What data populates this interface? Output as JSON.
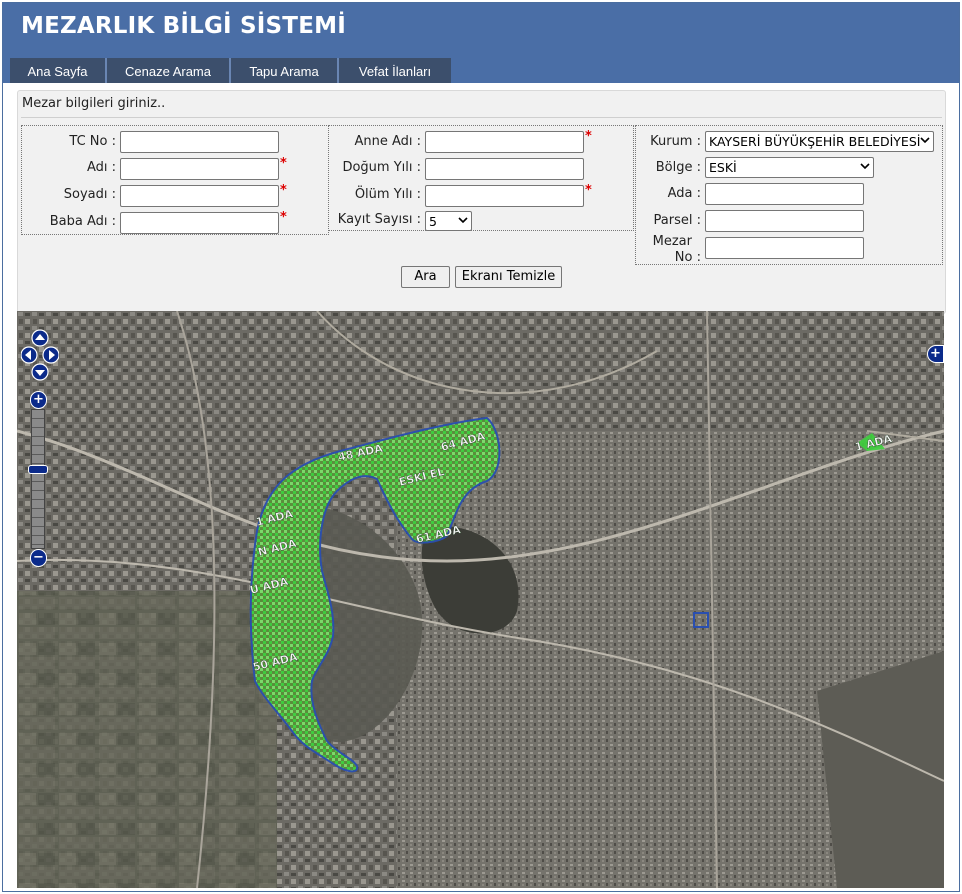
{
  "header": {
    "title": "MEZARLIK BİLGİ SİSTEMİ"
  },
  "nav": {
    "tabs": [
      {
        "label": "Ana Sayfa"
      },
      {
        "label": "Cenaze Arama"
      },
      {
        "label": "Tapu Arama"
      },
      {
        "label": "Vefat İlanları"
      }
    ]
  },
  "form": {
    "info_text": "Mezar bilgileri giriniz..",
    "col1": {
      "tc_label": "TC No :",
      "adi_label": "Adı :",
      "soyadi_label": "Soyadı :",
      "baba_label": "Baba Adı :"
    },
    "col2": {
      "anne_label": "Anne Adı :",
      "dogum_label": "Doğum Yılı :",
      "olum_label": "Ölüm Yılı :",
      "kayit_label": "Kayıt Sayısı :",
      "kayit_value": "5"
    },
    "col3": {
      "kurum_label": "Kurum :",
      "kurum_value": "KAYSERİ BÜYÜKŞEHİR BELEDİYESİ",
      "bolge_label": "Bölge :",
      "bolge_value": "ESKİ",
      "ada_label": "Ada :",
      "parsel_label": "Parsel :",
      "mezar_label_1": "Mezar",
      "mezar_label_2": "No :"
    },
    "required_mark": "*",
    "search_button": "Ara",
    "clear_button": "Ekranı Temizle"
  },
  "map": {
    "labels": {
      "ada48": "48 ADA",
      "ada64": "64 ADA",
      "eski": "ESKİ EL",
      "ada61": "61 ADA",
      "ada1": "1 ADA",
      "adaN": "N ADA",
      "adaU": "U ADA",
      "ada50": "50 ADA",
      "ada1b": "1 ADA"
    },
    "controls": {
      "zoom_in": "+",
      "zoom_out": "−",
      "layer_switcher": "+"
    },
    "colors": {
      "cemetery": "#3dd13d",
      "boundary": "#2a4fb0",
      "control": "#0b2a8a"
    }
  }
}
